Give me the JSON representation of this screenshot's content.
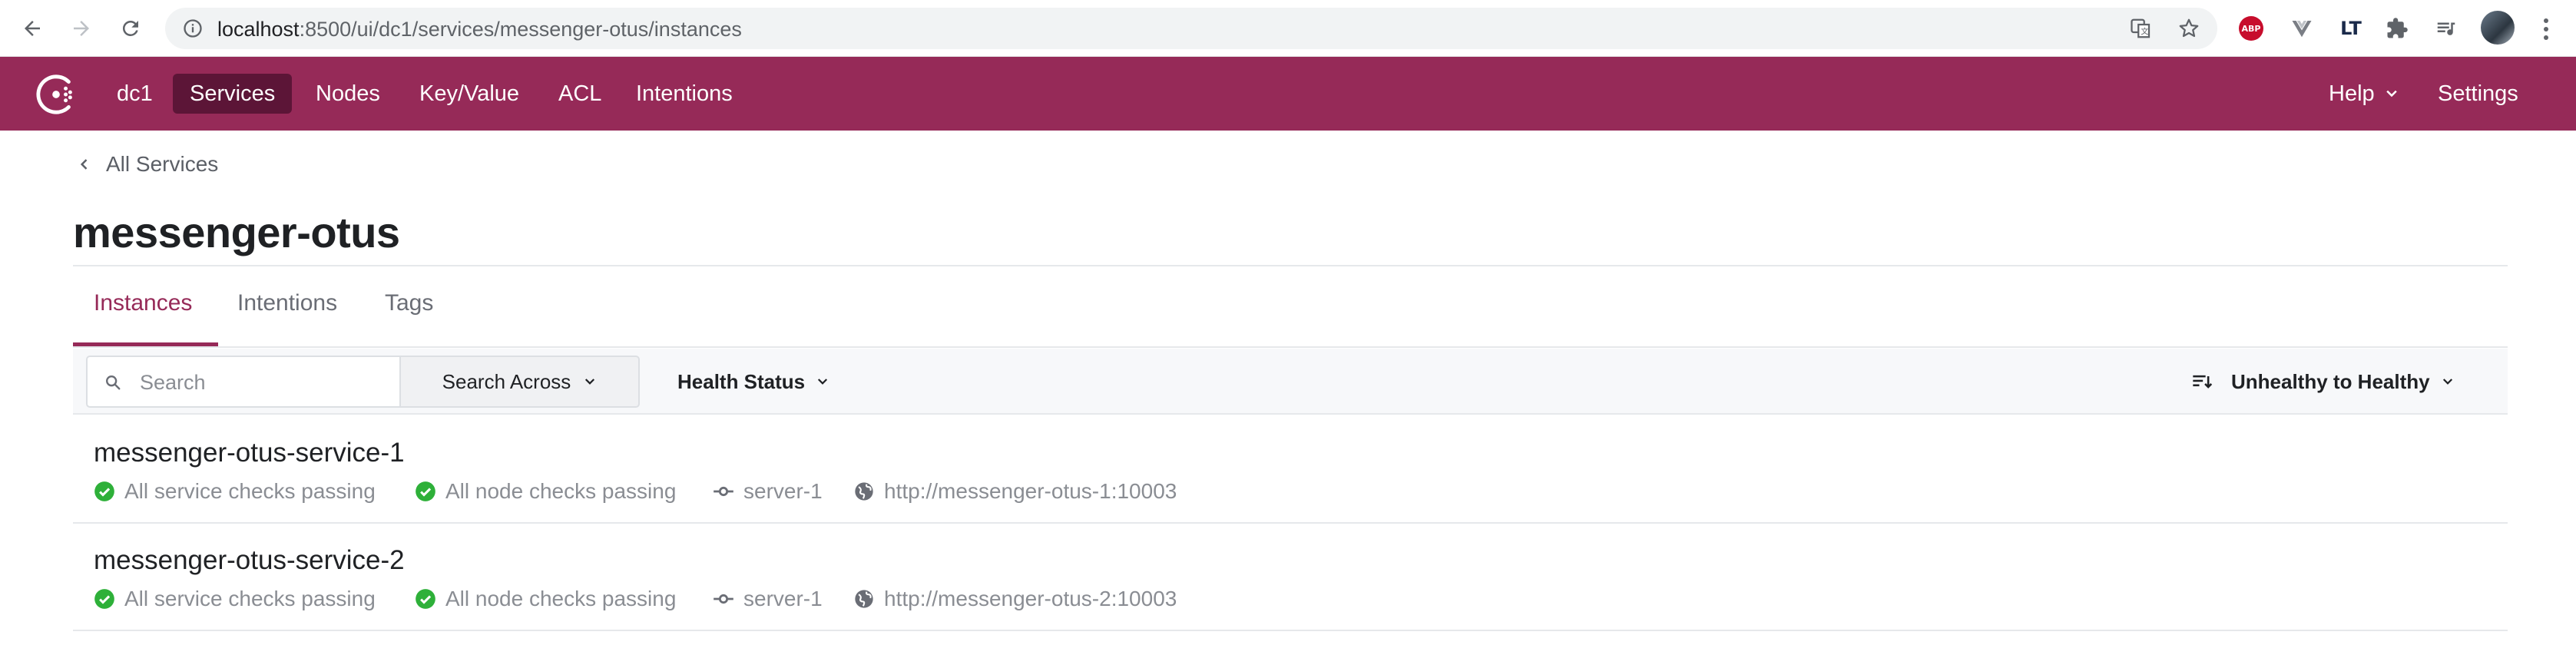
{
  "browser": {
    "url_host": "localhost",
    "url_path": ":8500/ui/dc1/services/messenger-otus/instances",
    "extensions": [
      "translate-icon",
      "star-icon",
      "adblock-plus-icon",
      "vue-devtools-icon",
      "languagetool-icon",
      "puzzle-icon",
      "media-queue-icon"
    ],
    "abp_label": "ABP",
    "lt_label": "LT"
  },
  "topnav": {
    "datacenter": "dc1",
    "items": [
      {
        "label": "Services",
        "active": true
      },
      {
        "label": "Nodes"
      },
      {
        "label": "Key/Value"
      },
      {
        "label": "ACL"
      },
      {
        "label": "Intentions"
      }
    ],
    "help": "Help",
    "settings": "Settings",
    "brand_color": "#962a58",
    "active_color": "#5c1537"
  },
  "breadcrumb": "All Services",
  "page_title": "messenger-otus",
  "tabs": [
    {
      "label": "Instances",
      "active": true
    },
    {
      "label": "Intentions"
    },
    {
      "label": "Tags"
    }
  ],
  "filters": {
    "search_placeholder": "Search",
    "search_across": "Search Across",
    "health_status": "Health Status",
    "sort": "Unhealthy to Healthy"
  },
  "instances": [
    {
      "name": "messenger-otus-service-1",
      "service_checks": "All service checks passing",
      "node_checks": "All node checks passing",
      "node": "server-1",
      "address": "http://messenger-otus-1:10003"
    },
    {
      "name": "messenger-otus-service-2",
      "service_checks": "All service checks passing",
      "node_checks": "All node checks passing",
      "node": "server-1",
      "address": "http://messenger-otus-2:10003"
    }
  ],
  "colors": {
    "passing": "#2eb039",
    "muted": "#8a8d93"
  }
}
